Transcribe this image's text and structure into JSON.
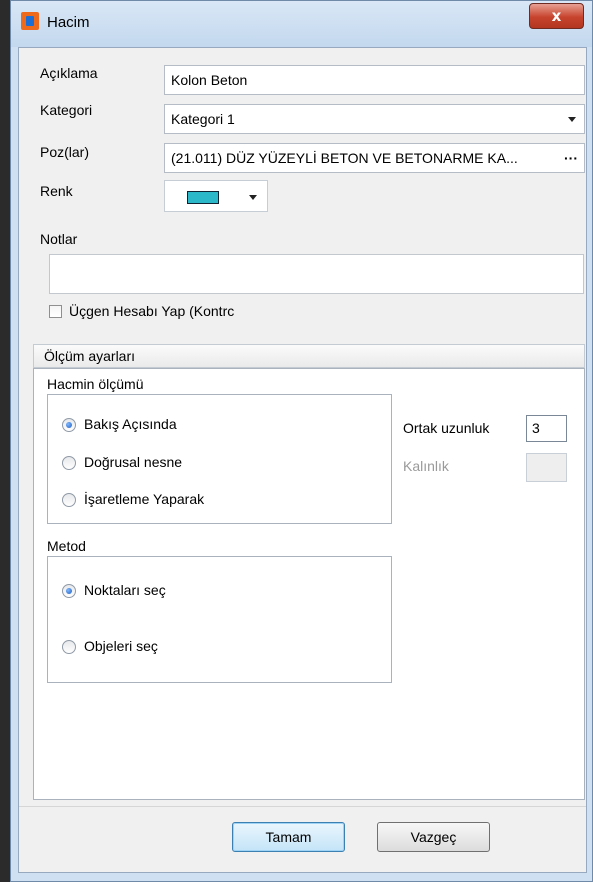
{
  "window": {
    "title": "Hacim",
    "close_label": "x"
  },
  "form": {
    "aciklama_label": "Açıklama",
    "aciklama_value": "Kolon Beton",
    "kategori_label": "Kategori",
    "kategori_value": "Kategori 1",
    "poz_label": "Poz(lar)",
    "poz_value": "(21.011) DÜZ YÜZEYLİ BETON VE BETONARME KA...",
    "poz_button": "···",
    "renk_label": "Renk",
    "renk_color": "#2bb8c8",
    "notlar_label": "Notlar",
    "notlar_value": "",
    "ucgen_label": "Üçgen Hesabı Yap (Kontrc",
    "ucgen_checked": false
  },
  "olcum": {
    "header": "Ölçüm ayarları",
    "hacmin_label": "Hacmin ölçümü",
    "hacmin_options": [
      "Bakış Açısında",
      "Doğrusal nesne",
      "İşaretleme Yaparak"
    ],
    "hacmin_selected": "Bakış Açısında",
    "ortak_label": "Ortak uzunluk",
    "ortak_value": "3",
    "kalinlik_label": "Kalınlık",
    "kalinlik_value": "",
    "metod_label": "Metod",
    "metod_options": [
      "Noktaları seç",
      "Objeleri seç"
    ],
    "metod_selected": "Noktaları seç"
  },
  "buttons": {
    "ok": "Tamam",
    "cancel": "Vazgeç"
  }
}
